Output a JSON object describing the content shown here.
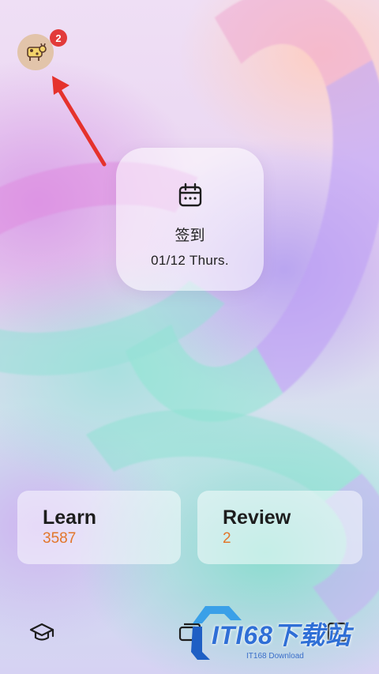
{
  "profile": {
    "notification_count": "2"
  },
  "checkin": {
    "title": "签到",
    "date": "01/12 Thurs."
  },
  "stats": {
    "learn": {
      "label": "Learn",
      "value": "3587"
    },
    "review": {
      "label": "Review",
      "value": "2"
    }
  },
  "watermark": {
    "title": "ITI68下载站",
    "subtitle": "IT168 Download"
  },
  "colors": {
    "accent_orange": "#e2762b",
    "badge_red": "#e23a3a",
    "annotation_arrow": "#e5322d",
    "watermark_blue": "#2f6fd6"
  },
  "icons": {
    "avatar": "cow-avatar-icon",
    "checkin": "calendar-icon",
    "nav_left": "graduation-cap-icon",
    "nav_middle": "cards-icon",
    "nav_right": "checklist-icon"
  }
}
